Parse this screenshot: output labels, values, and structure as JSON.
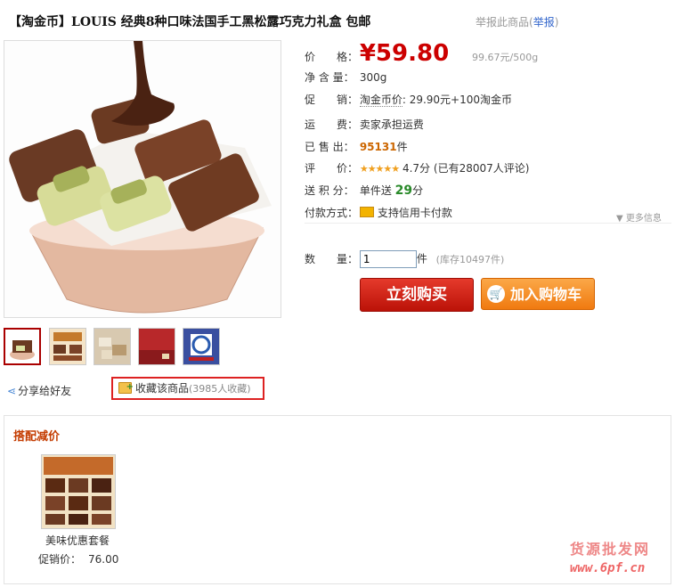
{
  "title": "【淘金币】LOUIS 经典8种口味法国手工黑松露巧克力礼盒 包邮",
  "report": {
    "text": "举报此商品",
    "link": "举报"
  },
  "price": {
    "label": "价　　格：",
    "value": "¥59.80",
    "unit_price": "99.67元/500g"
  },
  "net_weight": {
    "label": "净 含 量：",
    "value": "300g"
  },
  "promo": {
    "label": "促　　销：",
    "name": "淘金币价",
    "value": "29.90元+100淘金币"
  },
  "shipping": {
    "label": "运　　费：",
    "value": "卖家承担运费"
  },
  "sold": {
    "label": "已 售 出：",
    "value": "95131",
    "unit": "件"
  },
  "rating": {
    "label": "评　　价：",
    "stars": "★★★★★",
    "score": "4.7分",
    "reviews": "(已有28007人评论)"
  },
  "points": {
    "label": "送 积 分：",
    "prefix": "单件送",
    "value": "29",
    "unit": "分"
  },
  "payment": {
    "label": "付款方式：",
    "value": "支持信用卡付款"
  },
  "more_info": "▼ 更多信息",
  "quantity": {
    "label": "数　　量：",
    "value": "1",
    "unit": "件",
    "stock": "(库存10497件)"
  },
  "buttons": {
    "buy": "立刻购买",
    "cart": "加入购物车"
  },
  "share": "分享给好友",
  "favorite": {
    "text": "收藏该商品",
    "count": "(3985人收藏)"
  },
  "combo": {
    "title": "搭配减价",
    "name": "美味优惠套餐",
    "price_label": "促销价：",
    "price": "76.00"
  },
  "watermark": {
    "line1": "货源批发网",
    "line2": "www.6pf.cn"
  },
  "colors": {
    "price_red": "#cc0000",
    "buy_red": "#d02010",
    "cart_orange": "#f28a1c",
    "combo_title": "#c43c00"
  }
}
